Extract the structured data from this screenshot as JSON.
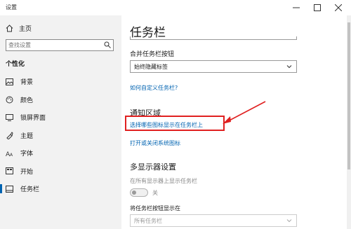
{
  "window": {
    "title": "设置"
  },
  "sidebar": {
    "home_label": "主页",
    "search_placeholder": "查找设置",
    "section_title": "个性化",
    "items": [
      {
        "label": "背景",
        "icon": "picture-icon"
      },
      {
        "label": "颜色",
        "icon": "palette-icon"
      },
      {
        "label": "锁屏界面",
        "icon": "lock-screen-icon"
      },
      {
        "label": "主题",
        "icon": "brush-icon"
      },
      {
        "label": "字体",
        "icon": "font-icon"
      },
      {
        "label": "开始",
        "icon": "start-icon"
      },
      {
        "label": "任务栏",
        "icon": "taskbar-icon"
      }
    ],
    "active": "任务栏"
  },
  "main": {
    "title": "任务栏",
    "combine_label": "合并任务栏按钮",
    "combine_value": "始终隐藏标签",
    "customize_link": "如何自定义任务栏?",
    "notify_heading": "通知区域",
    "select_icons_link": "选择哪些图标显示在任务栏上",
    "system_icons_link": "打开或关闭系统图标",
    "multi_heading": "多显示器设置",
    "show_all_label": "在所有显示器上显示任务栏",
    "toggle_state": "关",
    "show_buttons_label": "将任务栏按钮显示在",
    "show_buttons_value": "所有任务栏"
  },
  "colors": {
    "accent": "#0063b1",
    "highlight": "#e02020",
    "sidebar_bg": "#f2f2f2"
  }
}
